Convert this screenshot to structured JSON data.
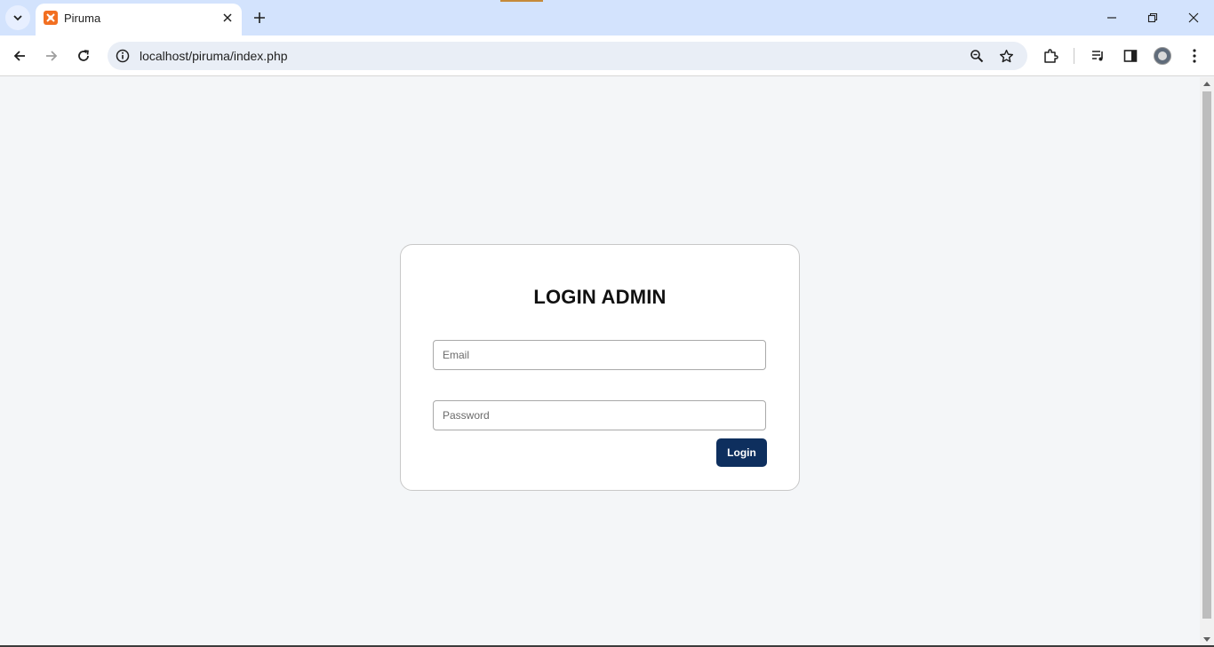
{
  "browser": {
    "tab_title": "Piruma",
    "url": "localhost/piruma/index.php"
  },
  "login": {
    "title": "LOGIN ADMIN",
    "email_placeholder": "Email",
    "password_placeholder": "Password",
    "button_label": "Login"
  },
  "colors": {
    "titlebar": "#d3e3fd",
    "page_background": "#f4f6f8",
    "button": "#0e2f5e",
    "favicon": "#f26f21"
  }
}
